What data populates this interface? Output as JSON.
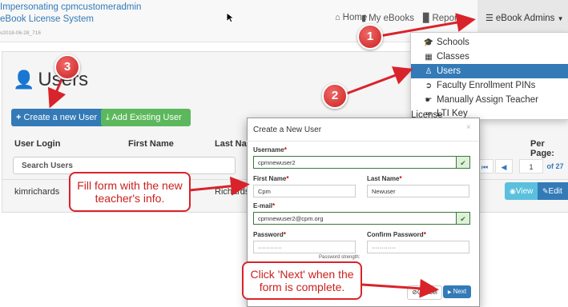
{
  "navbar": {
    "brand_line1": "Impersonating cpmcustomeradmin",
    "brand_line2": "eBook License System",
    "brand_version": "v2018-06-28_716",
    "home": "Home",
    "my_ebooks": "My eBooks",
    "reports": "Reports",
    "ebook_admins": "eBook Admins"
  },
  "dropdown": {
    "items": [
      "Schools",
      "Classes",
      "Users",
      "Faculty Enrollment PINs",
      "Manually Assign Teacher License",
      "LTI Key"
    ],
    "active_index": 2
  },
  "page": {
    "title": "Users",
    "create_button": "Create a new User",
    "add_button": "Add Existing User",
    "columns": [
      "User Login",
      "First Name",
      "Last Nam"
    ],
    "per_page_label": "Per Page:",
    "search_placeholder": "Search Users",
    "row": {
      "login": "kimrichards",
      "last": "Richards"
    },
    "pager": {
      "current": "1",
      "of_label": "of 27"
    },
    "view_button": "View",
    "edit_button": "Edit"
  },
  "modal": {
    "title": "Create a New User",
    "username_label": "Username",
    "username_value": "cpmnewuser2",
    "first_name_label": "First Name",
    "first_name_value": "Cpm",
    "last_name_label": "Last Name",
    "last_name_value": "Newuser",
    "email_label": "E-mail",
    "email_value": "cpmnewuser2@cpm.org",
    "password_label": "Password",
    "password_value": "············",
    "confirm_label": "Confirm Password",
    "confirm_value": "············",
    "strength_label": "Password strength:",
    "cancel": "Cancel",
    "next": "Next",
    "close": "×"
  },
  "annotations": {
    "badge1": "1",
    "badge2": "2",
    "badge3": "3",
    "callout_fill": "Fill form with the new teacher's info.",
    "callout_next": "Click 'Next' when the form is complete."
  },
  "colors": {
    "primary": "#337ab7",
    "success": "#5cb85c",
    "info": "#5bc0de",
    "annotation_red": "#d9232a"
  }
}
